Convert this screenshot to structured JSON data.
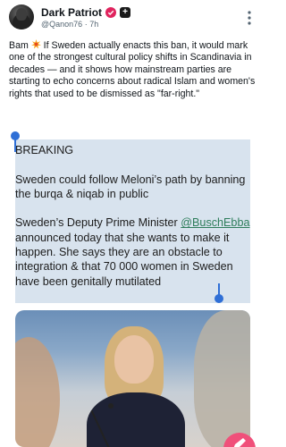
{
  "post": {
    "author_name": "Dark Patriot",
    "handle": "@Qanon76",
    "separator": "·",
    "time": "7h",
    "text_after_emoji": " If Sweden actually enacts this ban, it would mark one of the strongest cultural policy shifts in Scandinavia in decades — and it shows how mainstream parties are starting to echo concerns about radical Islam and women's rights that used to be dismissed as \"far-right.\"",
    "text_prefix": "Bam "
  },
  "quote": {
    "heading": "BREAKING",
    "para1": "Sweden could follow Meloni’s path by banning the burqa & niqab in public",
    "para2_prefix": "Sweden’s Deputy Prime Minister ",
    "mention": "@BuschEbba",
    "para2_suffix": " announced today that she wants to make it happen. She says they are an obstacle to integration & that 70 000 women in Sweden have been genitally mutilated"
  },
  "colors": {
    "selection_highlight": "#d8e3ee",
    "selection_handle": "#2f6fd6",
    "mention": "#2e7d5b",
    "fab": "#f0507a",
    "verified_badge": "#e0245e"
  },
  "icons": {
    "verified": "verified-badge-icon",
    "subscription": "plus-square-icon",
    "more": "more-vertical-icon",
    "emoji": "collision-emoji-icon",
    "compose": "compose-feather-icon"
  }
}
